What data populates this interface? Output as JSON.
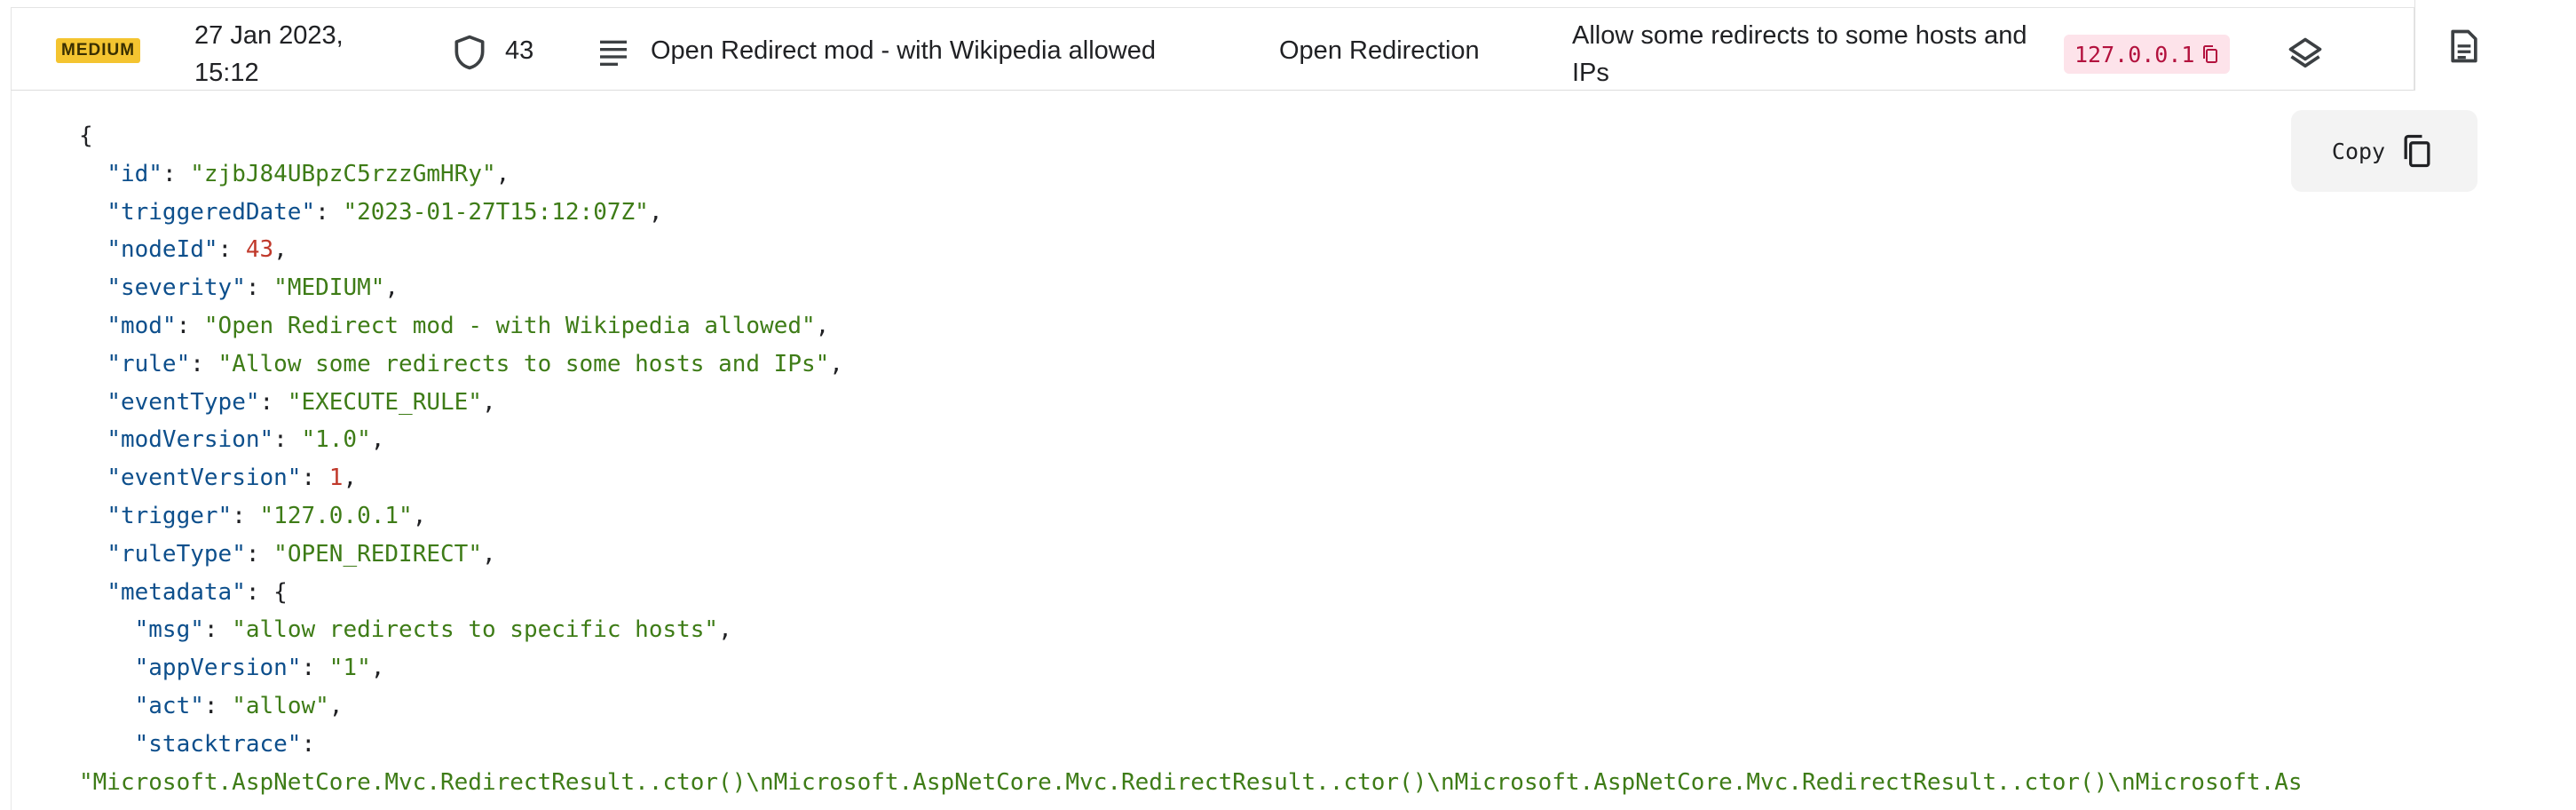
{
  "event_row": {
    "severity_badge": "MEDIUM",
    "date_line1": "27 Jan 2023,",
    "date_line2": "15:12",
    "node_id": "43",
    "mod_name": "Open Redirect mod - with Wikipedia allowed",
    "rule_type": "Open Redirection",
    "rule_line1": "Allow some redirects to some hosts and",
    "rule_line2": "IPs",
    "trigger_ip": "127.0.0.1",
    "icons": {
      "node": "shield-icon",
      "mod": "lines-icon",
      "copy_ip": "copy-icon",
      "details": "layers-icon",
      "json_tab": "document-icon"
    },
    "colors": {
      "severity_bg": "#f4c430",
      "ip_chip_bg": "#fde3ea",
      "ip_text": "#b3123e"
    }
  },
  "json_view": {
    "copy_label": "Copy",
    "open_brace": "{",
    "fields": [
      {
        "key": "\"id\"",
        "value": "\"zjbJ84UBpzC5rzzGmHRy\"",
        "type": "string",
        "indent": 1
      },
      {
        "key": "\"triggeredDate\"",
        "value": "\"2023-01-27T15:12:07Z\"",
        "type": "string",
        "indent": 1
      },
      {
        "key": "\"nodeId\"",
        "value": "43",
        "type": "number",
        "indent": 1
      },
      {
        "key": "\"severity\"",
        "value": "\"MEDIUM\"",
        "type": "string",
        "indent": 1
      },
      {
        "key": "\"mod\"",
        "value": "\"Open Redirect mod - with Wikipedia allowed\"",
        "type": "string",
        "indent": 1
      },
      {
        "key": "\"rule\"",
        "value": "\"Allow some redirects to some hosts and IPs\"",
        "type": "string",
        "indent": 1
      },
      {
        "key": "\"eventType\"",
        "value": "\"EXECUTE_RULE\"",
        "type": "string",
        "indent": 1
      },
      {
        "key": "\"modVersion\"",
        "value": "\"1.0\"",
        "type": "string",
        "indent": 1
      },
      {
        "key": "\"eventVersion\"",
        "value": "1",
        "type": "number",
        "indent": 1
      },
      {
        "key": "\"trigger\"",
        "value": "\"127.0.0.1\"",
        "type": "string",
        "indent": 1
      },
      {
        "key": "\"ruleType\"",
        "value": "\"OPEN_REDIRECT\"",
        "type": "string",
        "indent": 1
      },
      {
        "key": "\"metadata\"",
        "value": "{",
        "type": "open",
        "indent": 1
      },
      {
        "key": "\"msg\"",
        "value": "\"allow redirects to specific hosts\"",
        "type": "string",
        "indent": 2
      },
      {
        "key": "\"appVersion\"",
        "value": "\"1\"",
        "type": "string",
        "indent": 2
      },
      {
        "key": "\"act\"",
        "value": "\"allow\"",
        "type": "string",
        "indent": 2
      },
      {
        "key": "\"stacktrace\"",
        "value": "",
        "type": "wrap",
        "indent": 2
      }
    ],
    "stacktrace_value": "\"Microsoft.AspNetCore.Mvc.RedirectResult..ctor()\\nMicrosoft.AspNetCore.Mvc.RedirectResult..ctor()\\nMicrosoft.AspNetCore.Mvc.RedirectResult..ctor()\\nMicrosoft.As",
    "colors": {
      "key": "#0d4f8c",
      "string": "#3e7c17",
      "number": "#c0392b"
    }
  }
}
